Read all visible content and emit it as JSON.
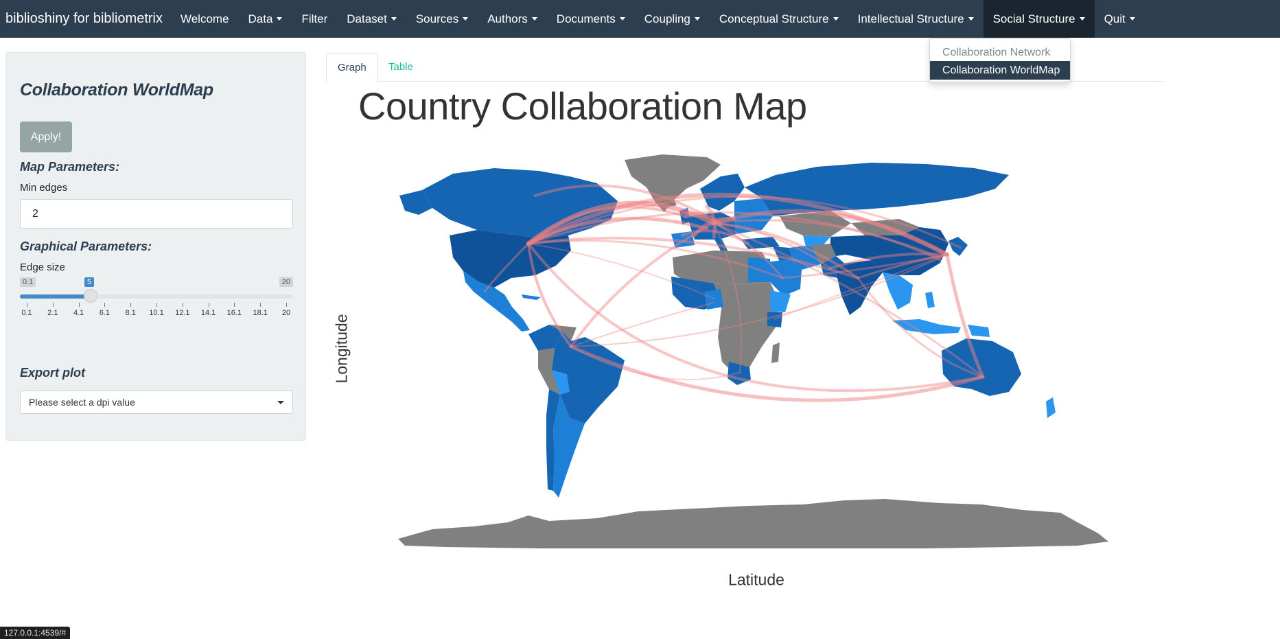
{
  "navbar": {
    "brand": "biblioshiny for bibliometrix",
    "items": [
      {
        "label": "Welcome",
        "dropdown": false
      },
      {
        "label": "Data",
        "dropdown": true
      },
      {
        "label": "Filter",
        "dropdown": false
      },
      {
        "label": "Dataset",
        "dropdown": true
      },
      {
        "label": "Sources",
        "dropdown": true
      },
      {
        "label": "Authors",
        "dropdown": true
      },
      {
        "label": "Documents",
        "dropdown": true
      },
      {
        "label": "Coupling",
        "dropdown": true
      },
      {
        "label": "Conceptual Structure",
        "dropdown": true
      },
      {
        "label": "Intellectual Structure",
        "dropdown": true
      },
      {
        "label": "Social Structure",
        "dropdown": true,
        "active": true
      },
      {
        "label": "Quit",
        "dropdown": true
      }
    ],
    "dropdown_items": [
      {
        "label": "Collaboration Network",
        "selected": false
      },
      {
        "label": "Collaboration WorldMap",
        "selected": true
      }
    ]
  },
  "sidebar": {
    "title": "Collaboration WorldMap",
    "apply_label": "Apply!",
    "map_params_heading": "Map Parameters:",
    "min_edges_label": "Min edges",
    "min_edges_value": "2",
    "graph_params_heading": "Graphical Parameters:",
    "edge_size_label": "Edge size",
    "edge_size": {
      "min": "0.1",
      "max": "20",
      "value": "5",
      "value_fraction": 0.246
    },
    "ticks": [
      "0.1",
      "2.1",
      "4.1",
      "6.1",
      "8.1",
      "10.1",
      "12.1",
      "14.1",
      "16.1",
      "18.1",
      "20"
    ],
    "export_heading": "Export plot",
    "dpi_placeholder": "Please select a dpi value"
  },
  "tabs": [
    {
      "label": "Graph",
      "active": true
    },
    {
      "label": "Table",
      "active": false
    }
  ],
  "plot": {
    "title": "Country Collaboration Map",
    "ylabel": "Longitude",
    "xlabel": "Latitude"
  },
  "colors": {
    "navbar": "#2c3e50",
    "country_dark": "#1565b3",
    "country_mid": "#1e7fd6",
    "country_light": "#2a96f0",
    "no_data": "#808080",
    "edge": "#f08080",
    "link": "#18bc9c"
  },
  "status_url": "127.0.0.1:4539/#"
}
